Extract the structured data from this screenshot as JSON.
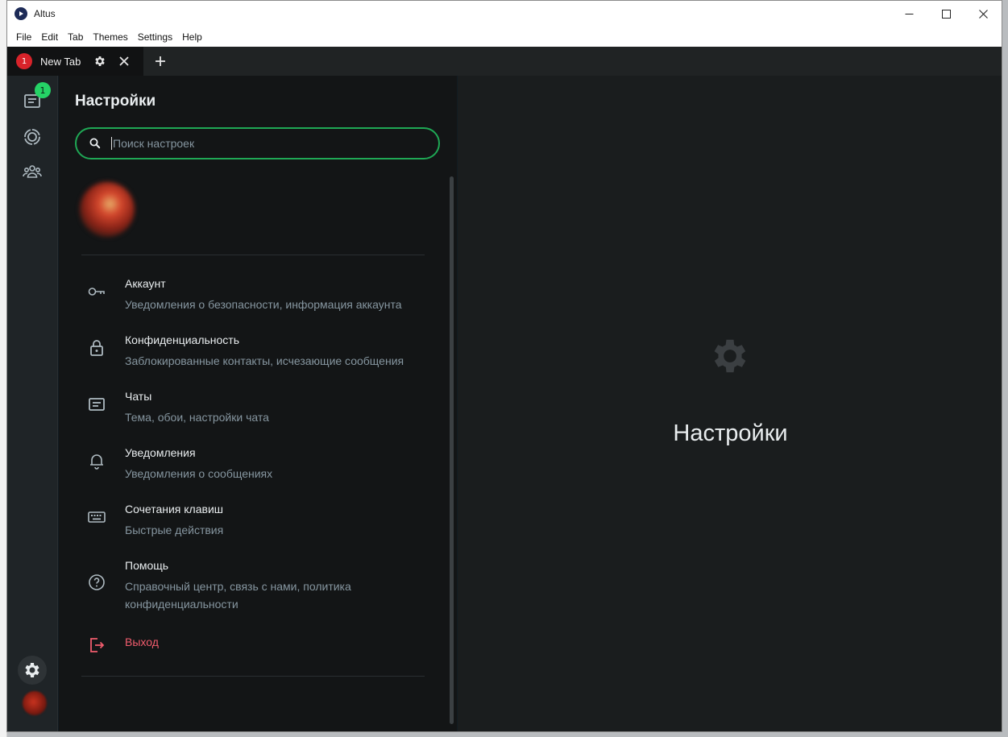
{
  "window": {
    "title": "Altus"
  },
  "menu": [
    "File",
    "Edit",
    "Tab",
    "Themes",
    "Settings",
    "Help"
  ],
  "tab": {
    "badge": "1",
    "label": "New Tab"
  },
  "rail": {
    "chats_badge": "1",
    "accent_color": "#25d366"
  },
  "settings": {
    "title": "Настройки",
    "search_placeholder": "Поиск настроек",
    "items": [
      {
        "icon": "key-icon",
        "title": "Аккаунт",
        "subtitle": "Уведомления о безопасности, информация аккаунта"
      },
      {
        "icon": "lock-icon",
        "title": "Конфиденциальность",
        "subtitle": "Заблокированные контакты, исчезающие сообщения"
      },
      {
        "icon": "chat-icon",
        "title": "Чаты",
        "subtitle": "Тема, обои, настройки чата"
      },
      {
        "icon": "bell-icon",
        "title": "Уведомления",
        "subtitle": "Уведомления о сообщениях"
      },
      {
        "icon": "keyboard-icon",
        "title": "Сочетания клавиш",
        "subtitle": "Быстрые действия"
      },
      {
        "icon": "help-icon",
        "title": "Помощь",
        "subtitle": "Справочный центр, связь с нами, политика конфиденциальности"
      }
    ],
    "logout": {
      "icon": "logout-icon",
      "title": "Выход",
      "color": "#f15c6d"
    }
  },
  "right_panel": {
    "title": "Настройки"
  }
}
